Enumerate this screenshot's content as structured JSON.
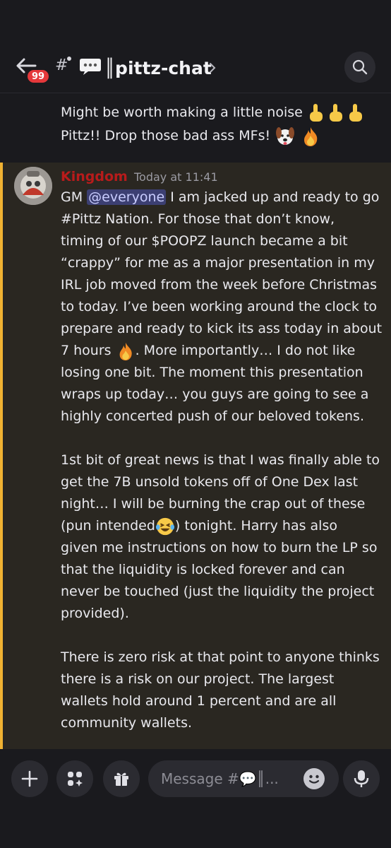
{
  "header": {
    "unread_count": "99",
    "channel_name": "║pittz-chat"
  },
  "previous_message": {
    "line1": "Might be worth making a little noise",
    "line2": "Pittz!! Drop those bad ass MFs!"
  },
  "message": {
    "author": "Kingdom",
    "timestamp": "Today at 11:41",
    "mention": "@everyone",
    "lines": [
      "I am jacked up and ready to go",
      "#Pittz Nation.  For those that don’t know,",
      "timing of our $POOPZ launch became a bit",
      "“crappy” for me as a major presentation in my",
      "IRL job moved from the week before Christmas",
      "to today.  I’ve been working around the clock to",
      "prepare and ready to kick its ass today in about",
      "7 hours",
      ".  More importantly… I do not like",
      "losing one bit.  The moment this presentation",
      "wraps up today… you guys are going to see a",
      "highly concerted push of our beloved tokens.",
      "1st bit of great news is that I was finally able to",
      "get the 7B unsold tokens off of One Dex last",
      "night… I will be burning the crap out of these",
      "(pun intended",
      ") tonight.  Harry has also",
      "given me instructions on how to burn the LP so",
      "that the liquidity is locked forever and can",
      "never be touched (just the liquidity the project",
      "provided).",
      "There is zero risk at that point to anyone thinks",
      "there is a risk on our project.  The largest",
      "wallets hold around 1 percent and are all",
      "community wallets."
    ],
    "gm": "GM"
  },
  "composer": {
    "placeholder": "Message #💬║..."
  },
  "colors": {
    "accent_highlight": "#f0b232",
    "author_color": "#b81b1b",
    "badge": "#e5383b",
    "mention_bg": "#3c3f72"
  },
  "icons": [
    "back-arrow-icon",
    "hash-icon",
    "speech-bubble-icon",
    "chevron-right-icon",
    "search-icon",
    "pointing-up-icon",
    "dog-face-icon",
    "fire-icon",
    "laughing-crying-icon",
    "plus-icon",
    "apps-icon",
    "gift-icon",
    "emoji-icon",
    "microphone-icon"
  ]
}
